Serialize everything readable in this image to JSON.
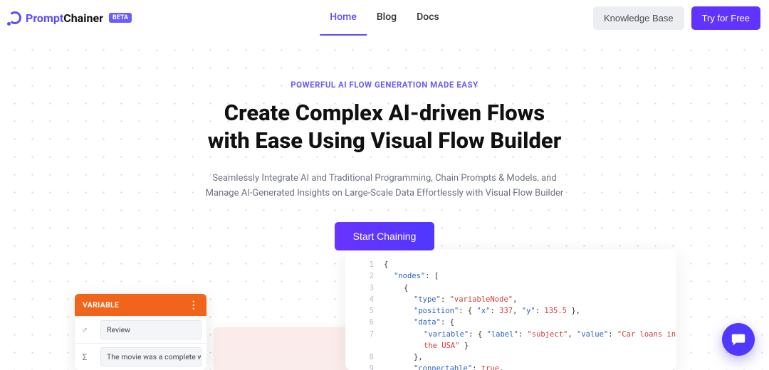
{
  "brand": {
    "name_a": "Prompt",
    "name_b": "Chainer",
    "badge": "BETA"
  },
  "nav": {
    "links": [
      "Home",
      "Blog",
      "Docs"
    ],
    "active_index": 0,
    "knowledge_base": "Knowledge Base",
    "try_free": "Try for Free"
  },
  "hero": {
    "eyebrow": "POWERFUL AI FLOW GENERATION MADE EASY",
    "headline_l1": "Create Complex AI-driven Flows",
    "headline_l2": "with Ease Using Visual Flow Builder",
    "sub_l1": "Seamlessly Integrate AI and Traditional Programming, Chain Prompts & Models, and",
    "sub_l2": "Manage AI-Generated Insights on Large-Scale Data Effortlessly with Visual Flow Builder",
    "cta": "Start Chaining"
  },
  "code": {
    "l1": "{",
    "l2a": "\"nodes\"",
    "l2b": ": [",
    "l3": "{",
    "l4a": "\"type\"",
    "l4b": ": ",
    "l4c": "\"variableNode\"",
    "l4d": ",",
    "l5a": "\"position\"",
    "l5b": ": { ",
    "l5c": "\"x\"",
    "l5d": ": ",
    "l5e": "337",
    "l5f": ", ",
    "l5g": "\"y\"",
    "l5h": ": ",
    "l5i": "135.5",
    "l5j": " },",
    "l6a": "\"data\"",
    "l6b": ": {",
    "l7a": "\"variable\"",
    "l7b": ": { ",
    "l7c": "\"label\"",
    "l7d": ": ",
    "l7e": "\"subject\"",
    "l7f": ", ",
    "l7g": "\"value\"",
    "l7h": ": ",
    "l7i": "\"Car loans in the USA\"",
    "l7j": " }",
    "l8": "},",
    "l9a": "\"connectable\"",
    "l9b": ": ",
    "l9c": "true",
    "l9d": ","
  },
  "variable_panel": {
    "title": "VARIABLE",
    "row1_icon": "♂",
    "row1_value": "Review",
    "row2_icon": "Σ",
    "row2_value": "The movie was a complete wast"
  }
}
